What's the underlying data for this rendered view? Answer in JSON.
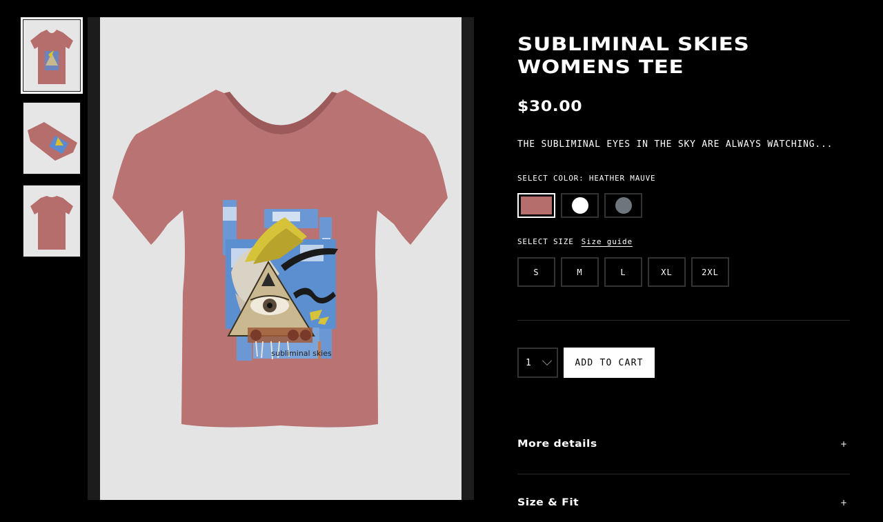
{
  "product": {
    "title_line1": "SUBLIMINAL SKIES",
    "title_line2": "WOMENS TEE",
    "price": "$30.00",
    "description": "THE SUBLIMINAL EYES IN THE SKY ARE ALWAYS WATCHING...",
    "shirt_print_text": "subliminal skies"
  },
  "color": {
    "label": "SELECT COLOR: HEATHER MAUVE",
    "swatches": [
      {
        "name": "heather-mauve",
        "hex": "#b66e6d"
      },
      {
        "name": "white",
        "hex": "#ffffff"
      },
      {
        "name": "gray",
        "hex": "#6e767c"
      }
    ]
  },
  "size": {
    "label": "SELECT SIZE",
    "guide_link": "Size guide",
    "options": [
      "S",
      "M",
      "L",
      "XL",
      "2XL"
    ]
  },
  "cart": {
    "quantity": "1",
    "add_label": "ADD TO CART"
  },
  "accordions": {
    "more_details": "More details",
    "size_fit": "Size & Fit",
    "plus": "+"
  },
  "colors": {
    "background": "#000000",
    "shirt": "#b66e6d",
    "image_bg": "#e4e4e4"
  }
}
